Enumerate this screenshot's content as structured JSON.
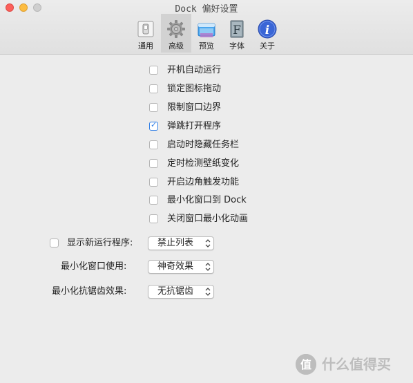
{
  "window": {
    "title": "Dock 偏好设置"
  },
  "toolbar": {
    "tabs": [
      {
        "label": "通用",
        "icon": "switch-icon"
      },
      {
        "label": "高级",
        "icon": "gear-icon",
        "selected": true
      },
      {
        "label": "预览",
        "icon": "preview-window-icon"
      },
      {
        "label": "字体",
        "icon": "font-icon"
      },
      {
        "label": "关于",
        "icon": "info-icon"
      }
    ]
  },
  "options": [
    {
      "label": "开机自动运行",
      "checked": false
    },
    {
      "label": "锁定图标拖动",
      "checked": false
    },
    {
      "label": "限制窗口边界",
      "checked": false
    },
    {
      "label": "弹跳打开程序",
      "checked": true
    },
    {
      "label": "启动时隐藏任务栏",
      "checked": false
    },
    {
      "label": "定时检测壁纸变化",
      "checked": false
    },
    {
      "label": "开启边角触发功能",
      "checked": false
    },
    {
      "label": "最小化窗口到 Dock",
      "checked": false
    },
    {
      "label": "关闭窗口最小化动画",
      "checked": false
    }
  ],
  "settings": {
    "show_new": {
      "label": "显示新运行程序:",
      "value": "禁止列表",
      "checked": false
    },
    "minimize_use": {
      "label": "最小化窗口使用:",
      "value": "神奇效果"
    },
    "antialias": {
      "label": "最小化抗锯齿效果:",
      "value": "无抗锯齿"
    }
  },
  "watermark": {
    "text": "什么值得买",
    "logo_glyph": "值"
  },
  "colors": {
    "accent": "#2f7ee6",
    "info_blue": "#3a66d6",
    "window_bg": "#ececec"
  }
}
